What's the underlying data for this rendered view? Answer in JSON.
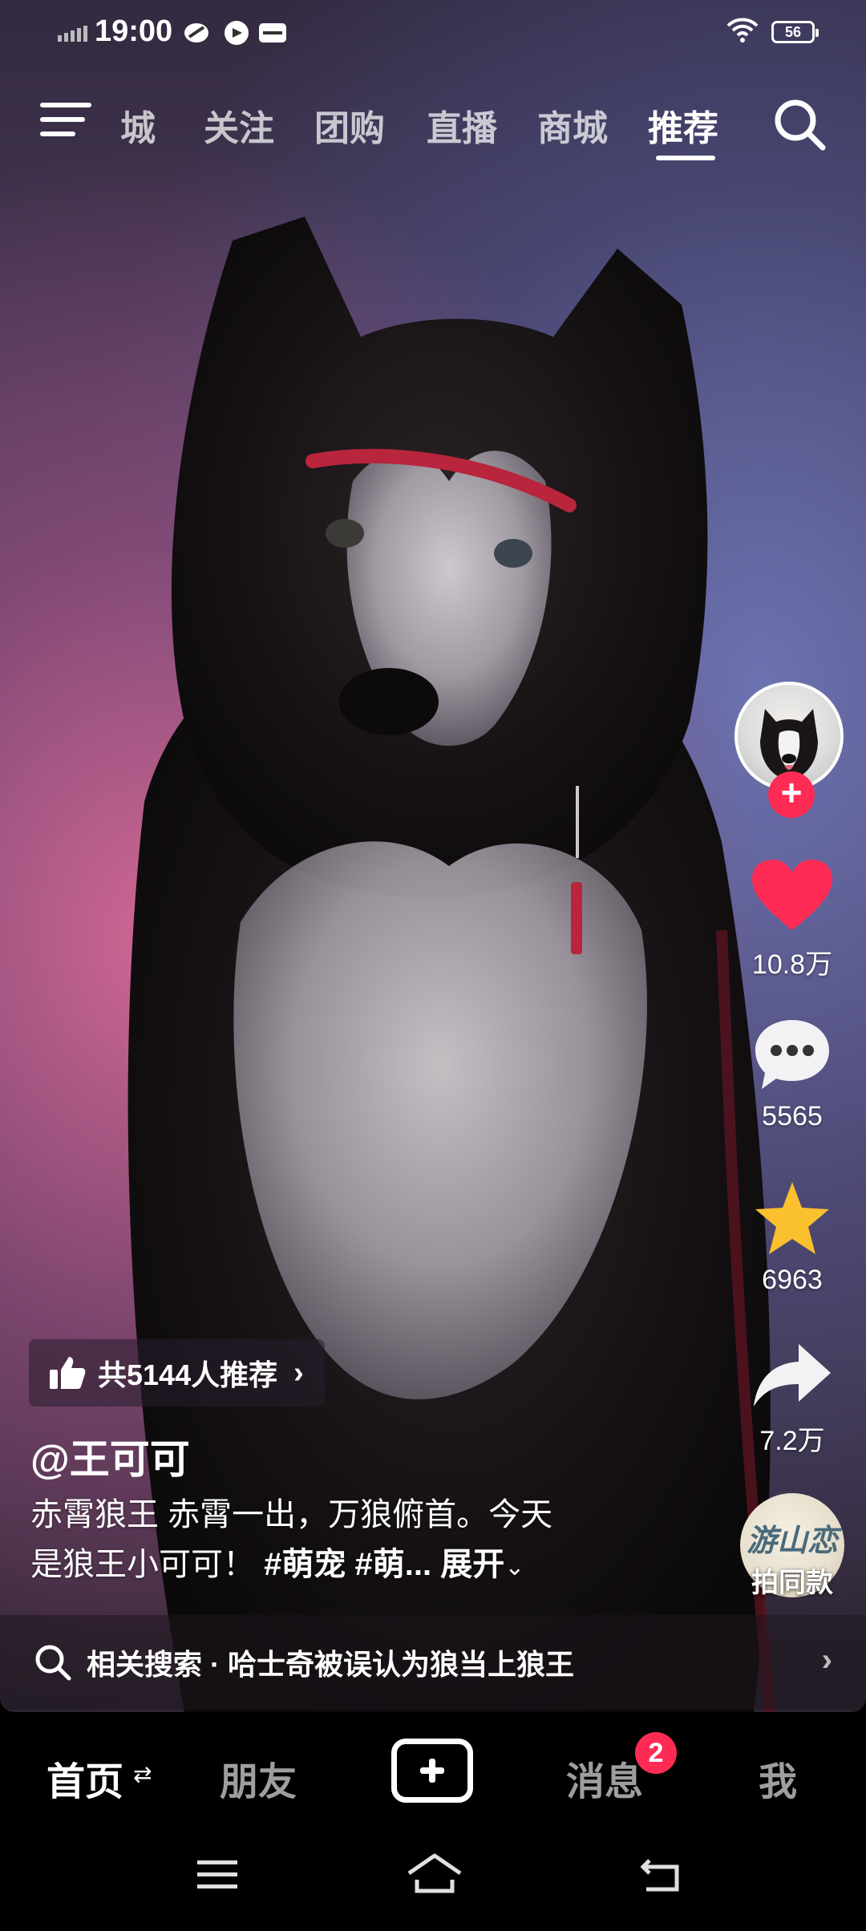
{
  "status_bar": {
    "time": "19:00",
    "battery": "56",
    "icons": [
      "signal-icon",
      "notification-icon",
      "chat-icon",
      "vivo-icon",
      "wifi-icon",
      "battery-icon"
    ]
  },
  "top_nav": {
    "tabs": [
      {
        "label": "城",
        "active": false
      },
      {
        "label": "关注",
        "active": false
      },
      {
        "label": "团购",
        "active": false
      },
      {
        "label": "直播",
        "active": false
      },
      {
        "label": "商城",
        "active": false
      },
      {
        "label": "推荐",
        "active": true
      }
    ]
  },
  "actions": {
    "likes": "10.8万",
    "comments": "5565",
    "favorites": "6963",
    "shares": "7.2万",
    "same_style_label": "拍同款",
    "same_style_thumb_text": "游山恋"
  },
  "video_info": {
    "recommend_text": "共5144人推荐",
    "author": "@王可可",
    "caption_line1": "赤霄狼王 赤霄一出，万狼俯首。今天",
    "caption_line2_text": "是狼王小可可！",
    "caption_tags": "#萌宠 #萌...",
    "expand_label": "展开"
  },
  "related_search": {
    "text": "相关搜索 · 哈士奇被误认为狼当上狼王"
  },
  "bottom_tabs": {
    "home": "首页",
    "friends": "朋友",
    "messages": "消息",
    "messages_badge": "2",
    "me": "我"
  },
  "colors": {
    "accent_red": "#fe2c55",
    "favorite_yellow": "#fbc02d"
  }
}
